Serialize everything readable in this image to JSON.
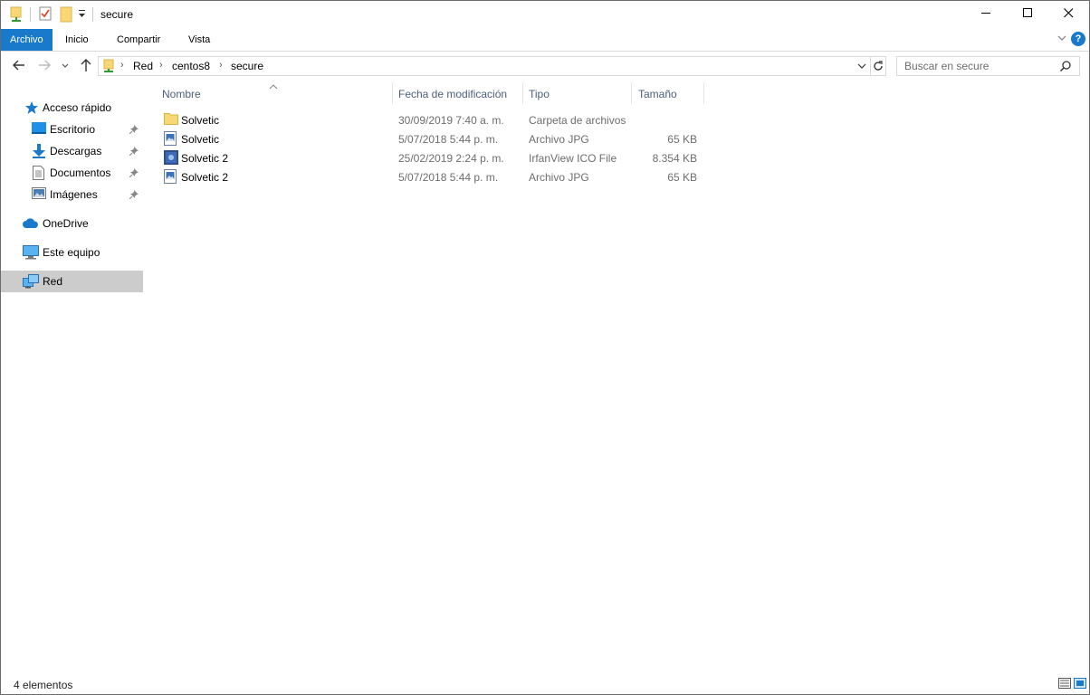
{
  "window": {
    "title": "secure",
    "controls": {
      "minimize": "minimize",
      "maximize": "maximize",
      "close": "close"
    }
  },
  "ribbon": {
    "tabs": [
      "Archivo",
      "Inicio",
      "Compartir",
      "Vista"
    ],
    "help": "?"
  },
  "navigation": {
    "breadcrumb": [
      "Red",
      "centos8",
      "secure"
    ],
    "search": {
      "placeholder": "Buscar en secure",
      "value": ""
    }
  },
  "sidebar": {
    "items": [
      {
        "label": "Acceso rápido",
        "icon": "star-icon",
        "pinned": false
      },
      {
        "label": "Escritorio",
        "icon": "desktop-icon",
        "pinned": true
      },
      {
        "label": "Descargas",
        "icon": "download-icon",
        "pinned": true
      },
      {
        "label": "Documentos",
        "icon": "document-icon",
        "pinned": true
      },
      {
        "label": "Imágenes",
        "icon": "pictures-icon",
        "pinned": true
      },
      {
        "label": "OneDrive",
        "icon": "cloud-icon",
        "pinned": false
      },
      {
        "label": "Este equipo",
        "icon": "computer-icon",
        "pinned": false
      },
      {
        "label": "Red",
        "icon": "network-icon",
        "pinned": false,
        "selected": true
      }
    ]
  },
  "file_list": {
    "columns": [
      "Nombre",
      "Fecha de modificación",
      "Tipo",
      "Tamaño"
    ],
    "rows": [
      {
        "name": "Solvetic",
        "date": "30/09/2019 7:40 a. m.",
        "type": "Carpeta de archivos",
        "size": "",
        "icon": "folder-icon"
      },
      {
        "name": "Solvetic",
        "date": "5/07/2018 5:44 p. m.",
        "type": "Archivo JPG",
        "size": "65 KB",
        "icon": "image-file-icon"
      },
      {
        "name": "Solvetic 2",
        "date": "25/02/2019 2:24 p. m.",
        "type": "IrfanView ICO File",
        "size": "8.354 KB",
        "icon": "ico-file-icon"
      },
      {
        "name": "Solvetic 2",
        "date": "5/07/2018 5:44 p. m.",
        "type": "Archivo JPG",
        "size": "65 KB",
        "icon": "image-file-icon"
      }
    ]
  },
  "status": {
    "item_count": "4 elementos"
  },
  "colors": {
    "accent": "#1979ca",
    "selected": "#cccccc",
    "header_text": "#4c607a",
    "folder": "#f8d775"
  }
}
